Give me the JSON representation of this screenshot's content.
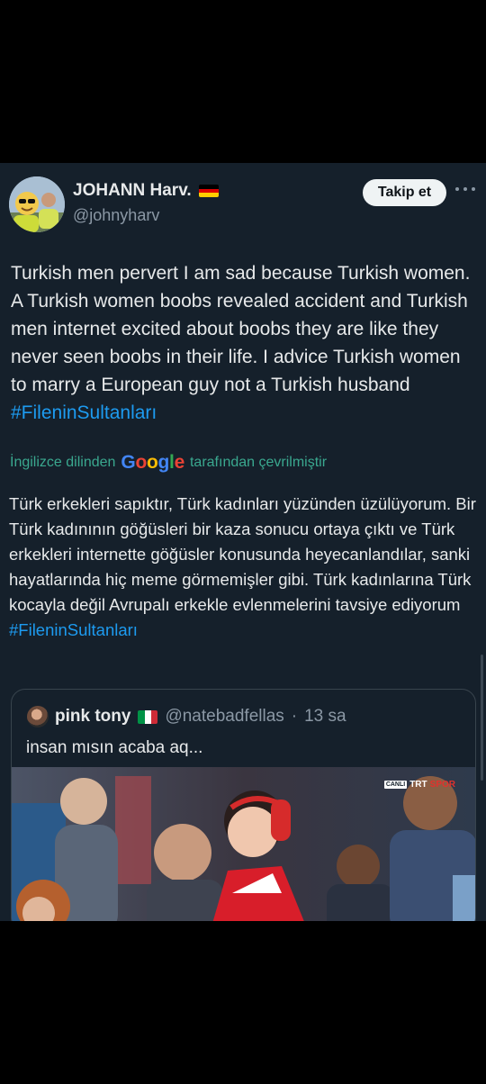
{
  "tweet": {
    "author_name": "JOHANN Harv.",
    "author_flag": "germany-flag",
    "handle": "@johnyharv",
    "follow_label": "Takip et",
    "body_parts": [
      "Turkish men pervert I am sad because Turkish women. A Turkish women boobs revealed accident and Turkish men internet excited about boobs they are  like they never seen boobs in their life. I advice Turkish women to marry a European guy not a Turkish husband ",
      "#FileninSultanları"
    ],
    "translation": {
      "prefix": "İngilizce dilinden",
      "logo": "Google",
      "suffix": "tarafından çevrilmiştir",
      "text": "Türk erkekleri sapıktır, Türk kadınları yüzünden üzülüyorum. Bir Türk kadınının göğüsleri bir kaza sonucu ortaya çıktı ve Türk erkekleri internette göğüsler konusunda heyecanlandılar, sanki hayatlarında hiç meme görmemişler gibi. Türk kadınlarına Türk kocayla değil Avrupalı erkekle evlenmelerini tavsiye ediyorum ",
      "hashtag": "#FileninSultanları"
    }
  },
  "quoted": {
    "author_name": "pink tony",
    "author_flag": "italy-flag",
    "handle": "@natebadfellas",
    "separator": "·",
    "time": "13 sa",
    "text": "insan mısın acaba aq...",
    "watermark": {
      "live": "CANLI",
      "brand": "TRT",
      "brand_accent": "SPOR"
    }
  },
  "colors": {
    "background": "#15202b",
    "link": "#1d9bf0",
    "translate_accent": "#3aa88f",
    "secondary_text": "#8b98a5"
  }
}
